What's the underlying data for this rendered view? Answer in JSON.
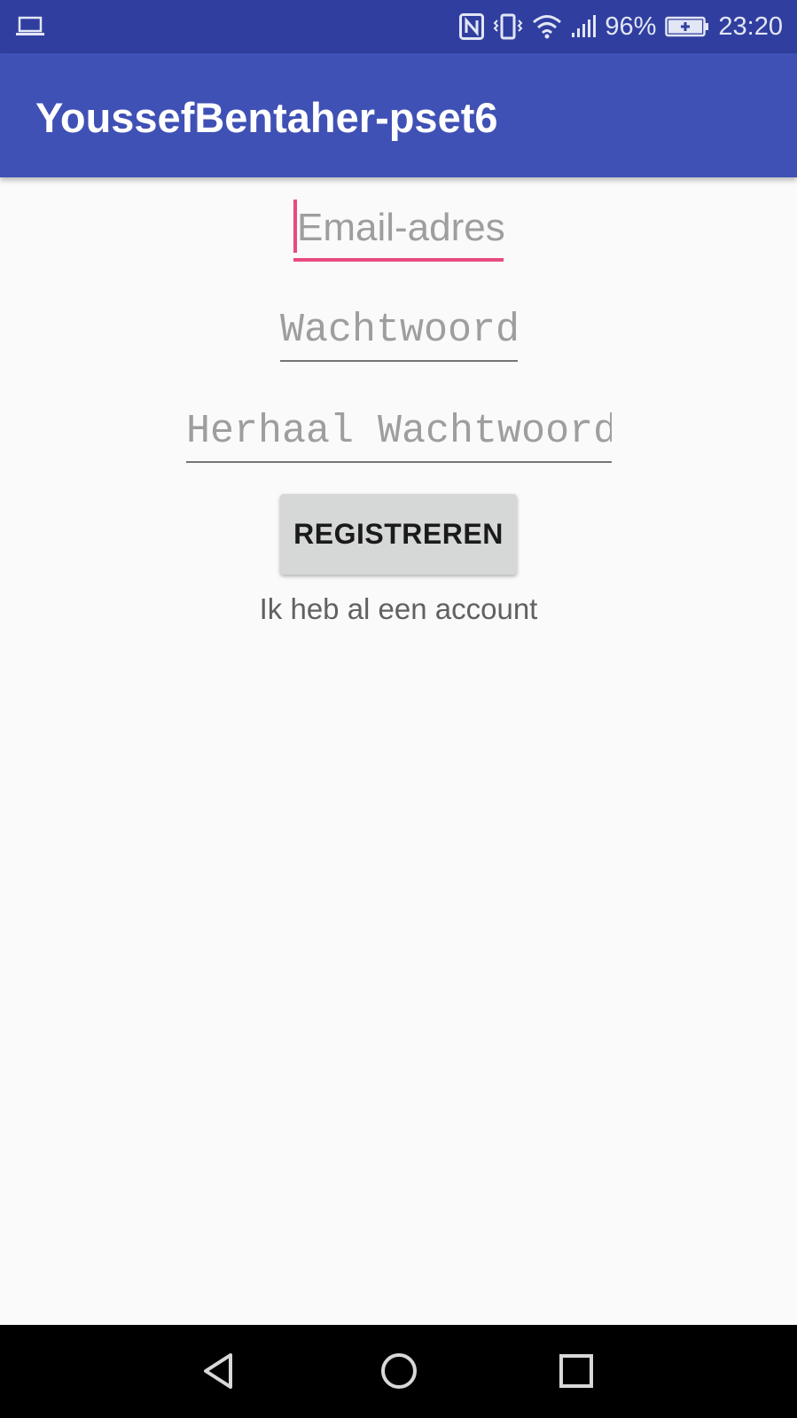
{
  "status_bar": {
    "left_icon": "laptop-icon",
    "icons": [
      "nfc-icon",
      "vibrate-icon",
      "wifi-icon",
      "signal-icon"
    ],
    "battery_percent": "96%",
    "battery_icon": "battery-charging-icon",
    "time": "23:20"
  },
  "app_bar": {
    "title": "YoussefBentaher-pset6"
  },
  "form": {
    "email_placeholder": "Email-adres",
    "password_placeholder": "Wachtwoord",
    "repeat_password_placeholder": "Herhaal Wachtwoord",
    "register_label": "REGISTREREN",
    "login_link": "Ik heb al een account"
  },
  "colors": {
    "status_bar": "#303f9f",
    "app_bar": "#3f51b5",
    "accent": "#e84a7f",
    "button": "#d6d7d7",
    "background": "#fafafa"
  },
  "nav_bar": {
    "buttons": [
      "back-icon",
      "home-icon",
      "recents-icon"
    ]
  }
}
